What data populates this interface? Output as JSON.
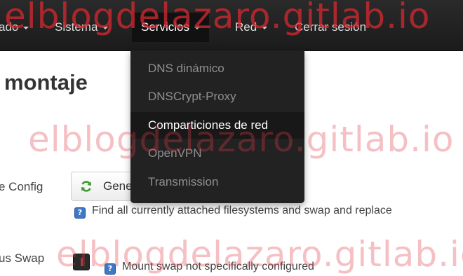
{
  "navbar": {
    "items": [
      {
        "label": "ado",
        "has_caret": true
      },
      {
        "label": "Sistema",
        "has_caret": true
      },
      {
        "label": "Servicios",
        "has_caret": true
      },
      {
        "label": "Red",
        "has_caret": true
      },
      {
        "label": "Cerrar sesión",
        "has_caret": false
      }
    ],
    "active_item": "Servicios"
  },
  "dropdown": {
    "items": [
      {
        "label": "DNS dinámico"
      },
      {
        "label": "DNSCrypt-Proxy"
      },
      {
        "label": "Comparticiones de red"
      },
      {
        "label": "OpenVPN"
      },
      {
        "label": "Transmission"
      }
    ],
    "hovered_item": "Comparticiones de red"
  },
  "main": {
    "title": "montaje",
    "generate_config": {
      "label": "e Config",
      "button_label": "Generar configuración",
      "help_text": "Find all currently attached filesystems and swap and replace"
    },
    "anonymous_swap": {
      "label": "us Swap",
      "checked": false,
      "help_text": "Mount swap not specifically configured"
    }
  },
  "watermark": {
    "text": "elblogdelazaro.gitlab.io"
  },
  "colors": {
    "navbar_bg": "#1b1b1b",
    "dropdown_bg": "#222222",
    "help_icon": "#3d79c8",
    "watermark": "#e13c46"
  },
  "icons": {
    "refresh": "refresh-icon",
    "help": "question-icon",
    "caret": "caret-down-icon"
  }
}
